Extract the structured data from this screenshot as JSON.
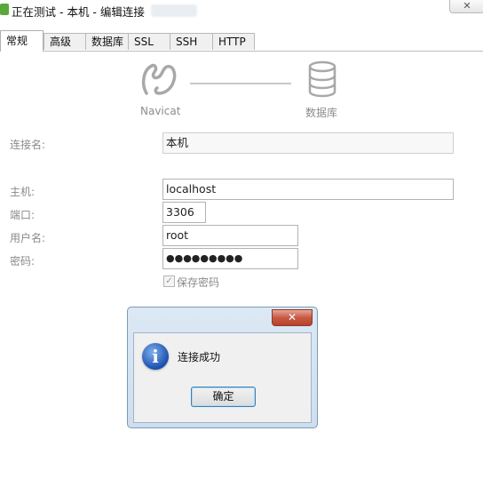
{
  "window": {
    "title": "正在测试 - 本机 - 编辑连接",
    "close_label": "✕"
  },
  "tabs": [
    {
      "label": "常规",
      "active": true
    },
    {
      "label": "高级",
      "active": false
    },
    {
      "label": "数据库",
      "active": false
    },
    {
      "label": "SSL",
      "active": false
    },
    {
      "label": "SSH",
      "active": false
    },
    {
      "label": "HTTP",
      "active": false
    }
  ],
  "diagram": {
    "left_label": "Navicat",
    "right_label": "数据库",
    "left_icon": "navicat-logo-icon",
    "right_icon": "database-icon"
  },
  "form": {
    "connection_name_label": "连接名:",
    "connection_name_value": "本机",
    "host_label": "主机:",
    "host_value": "localhost",
    "port_label": "端口:",
    "port_value": "3306",
    "username_label": "用户名:",
    "username_value": "root",
    "password_label": "密码:",
    "password_value": "●●●●●●●●●",
    "save_password_label": "保存密码",
    "save_password_checked": true
  },
  "dialog": {
    "close_label": "✕",
    "message": "连接成功",
    "ok_label": "确定",
    "icon": "info-icon"
  },
  "colors": {
    "dialog_frame": "#cfdeee",
    "dialog_close": "#c75a44",
    "info_icon": "#1a4fb0",
    "button_focus": "#3c7fb1"
  }
}
